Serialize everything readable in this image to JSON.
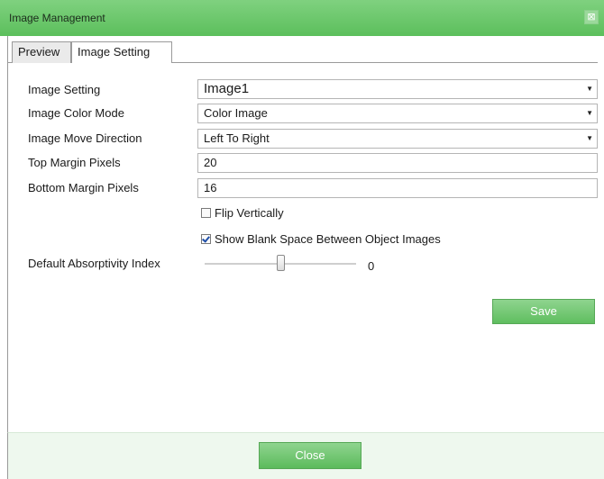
{
  "window": {
    "title": "Image Management",
    "close_glyph": "⊠"
  },
  "tabs": [
    {
      "label": "Preview",
      "active": false
    },
    {
      "label": "Image Setting",
      "active": true
    }
  ],
  "form": {
    "image_setting": {
      "label": "Image Setting",
      "value": "Image1"
    },
    "color_mode": {
      "label": "Image Color Mode",
      "value": "Color Image"
    },
    "move_direction": {
      "label": "Image Move Direction",
      "value": "Left To Right"
    },
    "top_margin": {
      "label": "Top Margin Pixels",
      "value": "20"
    },
    "bottom_margin": {
      "label": "Bottom Margin Pixels",
      "value": "16"
    },
    "flip_vertically": {
      "label": "Flip Vertically",
      "checked": false
    },
    "show_blank_space": {
      "label": "Show Blank Space Between Object Images",
      "checked": true
    },
    "absorptivity": {
      "label": "Default Absorptivity Index",
      "value": "0",
      "slider_fraction": 0.5
    }
  },
  "buttons": {
    "save": "Save",
    "close": "Close"
  },
  "colors": {
    "accent": "#5cbf5c",
    "footer_bg": "#eef8ee"
  }
}
